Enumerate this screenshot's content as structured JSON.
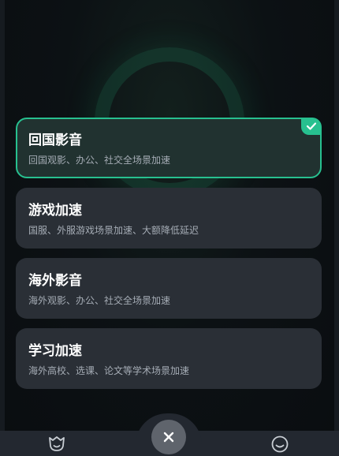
{
  "modes": [
    {
      "title": "回国影音",
      "desc": "回国观影、办公、社交全场景加速",
      "selected": true
    },
    {
      "title": "游戏加速",
      "desc": "国服、外服游戏场景加速、大额降低延迟",
      "selected": false
    },
    {
      "title": "海外影音",
      "desc": "海外观影、办公、社交全场景加速",
      "selected": false
    },
    {
      "title": "学习加速",
      "desc": "海外高校、选课、论文等学术场景加速",
      "selected": false
    }
  ],
  "icons": {
    "check": "check-icon",
    "close": "close-icon",
    "tab_left": "shield-face-icon",
    "tab_right": "smiley-icon"
  },
  "colors": {
    "accent": "#27c08f",
    "card_bg": "#2a2f36",
    "selected_bg": "#213230"
  }
}
